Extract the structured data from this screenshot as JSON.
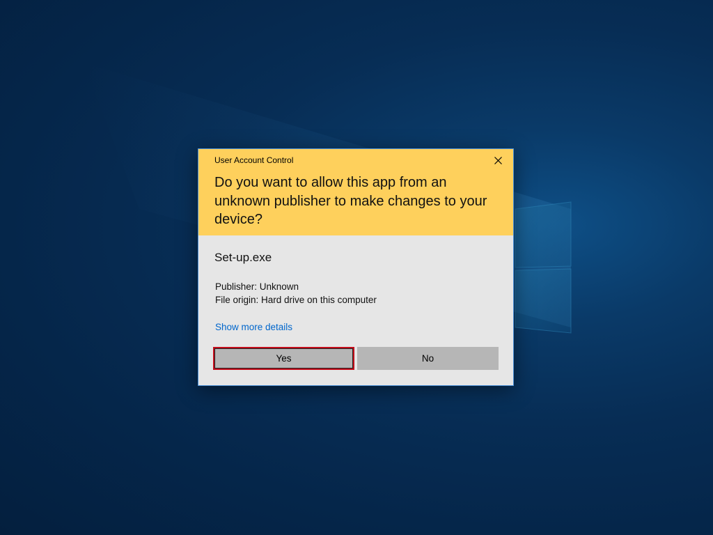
{
  "dialog": {
    "title": "User Account Control",
    "question": "Do you want to allow this app from an unknown publisher to make changes to your device?",
    "app_name": "Set-up.exe",
    "publisher": "Publisher: Unknown",
    "file_origin": "File origin: Hard drive on this computer",
    "details_link": "Show more details",
    "yes_label": "Yes",
    "no_label": "No",
    "close_icon": "close-icon"
  },
  "colors": {
    "header": "#fed05c",
    "body": "#e6e6e6",
    "link": "#0066cc",
    "button": "#b6b6b6",
    "focus_border": "#c40d1b",
    "desktop": "#072d55"
  }
}
